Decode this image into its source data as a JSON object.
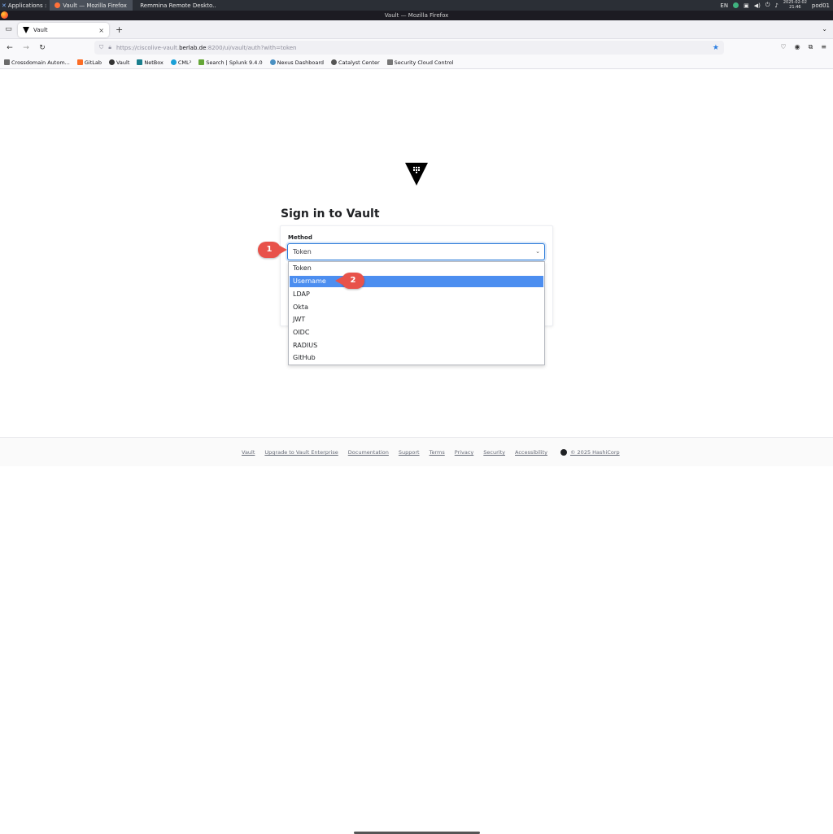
{
  "taskbar": {
    "apps_label": "Applications :",
    "windows": [
      {
        "label": "Vault — Mozilla Firefox",
        "icon": "firefox-icon"
      },
      {
        "label": "Remmina Remote Deskto...",
        "icon": "remmina-icon"
      }
    ],
    "lang": "EN",
    "date": "2025-02-02",
    "time": "21:46",
    "user": "pod01"
  },
  "window": {
    "title": "Vault — Mozilla Firefox"
  },
  "tabs": [
    {
      "label": "Vault",
      "icon": "vault-icon"
    }
  ],
  "navbar": {
    "url_prefix": "https://ciscolive-vault.",
    "url_domain": "berlab.de",
    "url_suffix": ":8200/ui/vault/auth?with=token"
  },
  "bookmarks": [
    {
      "label": "Crossdomain Autom...",
      "color": "#6b6b6b"
    },
    {
      "label": "GitLab",
      "color": "#fc6d26"
    },
    {
      "label": "Vault",
      "color": "#333333"
    },
    {
      "label": "NetBox",
      "color": "#1a7f8e"
    },
    {
      "label": "CML²",
      "color": "#1ba0d7"
    },
    {
      "label": "Search | Splunk 9.4.0",
      "color": "#65a637"
    },
    {
      "label": "Nexus Dashboard",
      "color": "#4a90c2"
    },
    {
      "label": "Catalyst Center",
      "color": "#555555"
    },
    {
      "label": "Security Cloud Control",
      "color": "#777777"
    }
  ],
  "signin": {
    "title": "Sign in to Vault",
    "method_label": "Method",
    "selected_method": "Token",
    "options": [
      "Token",
      "Username",
      "LDAP",
      "Okta",
      "JWT",
      "OIDC",
      "RADIUS",
      "GitHub"
    ],
    "highlighted_option": "Username"
  },
  "callouts": {
    "one": "1",
    "two": "2"
  },
  "footer": {
    "links": [
      "Vault",
      "Upgrade to Vault Enterprise",
      "Documentation",
      "Support",
      "Terms",
      "Privacy",
      "Security",
      "Accessibility"
    ],
    "copyright": "© 2025 HashiCorp"
  },
  "colors": {
    "accent": "#4c8ef0",
    "callout": "#e8524a"
  }
}
